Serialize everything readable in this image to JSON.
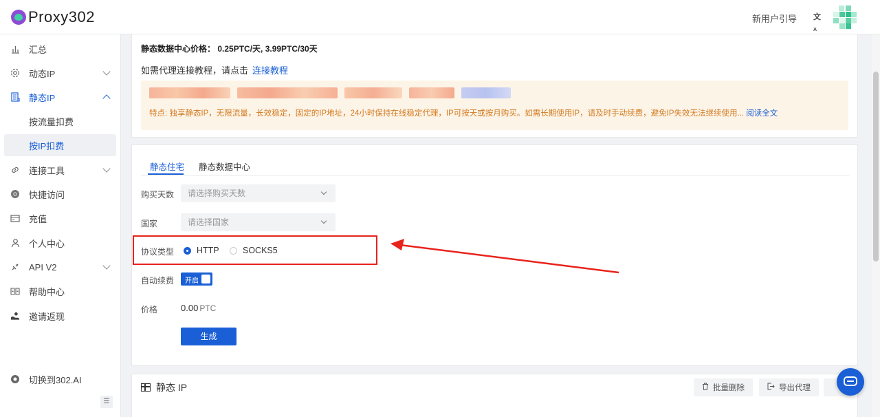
{
  "header": {
    "logo_text": "Proxy302",
    "guide_link": "新用户引导",
    "translate_icon": "translate-icon",
    "avatar_icon": "avatar"
  },
  "sidebar": {
    "items": [
      {
        "label": "汇总",
        "icon": "chart-icon"
      },
      {
        "label": "动态IP",
        "icon": "gear-icon"
      },
      {
        "label": "静态IP",
        "icon": "server-icon"
      },
      {
        "label": "按流量扣费"
      },
      {
        "label": "按IP扣费"
      },
      {
        "label": "连接工具",
        "icon": "link-icon"
      },
      {
        "label": "快捷访问",
        "icon": "chrome-icon"
      },
      {
        "label": "充值",
        "icon": "wallet-icon"
      },
      {
        "label": "个人中心",
        "icon": "user-icon"
      },
      {
        "label": "API V2",
        "icon": "api-icon"
      },
      {
        "label": "帮助中心",
        "icon": "book-icon"
      },
      {
        "label": "邀请返现",
        "icon": "gift-icon"
      }
    ],
    "switch_label": "切换到302.AI"
  },
  "info": {
    "price_line": "静态数据中心价格： 0.25PTC/天, 3.99PTC/30天",
    "tutorial_prefix": "如需代理连接教程，请点击",
    "tutorial_link": "连接教程",
    "notice_text": "特点: 独享静态IP，无限流量，长效稳定，固定的IP地址，24小时保持在线稳定代理，IP可按天或按月购买。如需长期使用IP，请及时手动续费，避免IP失效无法继续使用...",
    "read_more": "阅读全文"
  },
  "tabs": [
    "静态住宅",
    "静态数据中心"
  ],
  "form": {
    "days_label": "购买天数",
    "days_placeholder": "请选择购买天数",
    "country_label": "国家",
    "country_placeholder": "请选择国家",
    "protocol_label": "协议类型",
    "protocol_options": [
      "HTTP",
      "SOCKS5"
    ],
    "protocol_selected": "HTTP",
    "auto_renew_label": "自动续费",
    "auto_renew_state": "开启",
    "price_label": "价格",
    "price_value": "0.00",
    "price_unit": "PTC",
    "generate_button": "生成"
  },
  "static_ip": {
    "title": "静态 IP",
    "batch_delete": "批量删除",
    "export_proxy": "导出代理"
  },
  "colors": {
    "accent": "#1a5fd6",
    "annotation": "#e8231c",
    "notice_bg": "#fdf4e8",
    "notice_text": "#d27a1e"
  }
}
